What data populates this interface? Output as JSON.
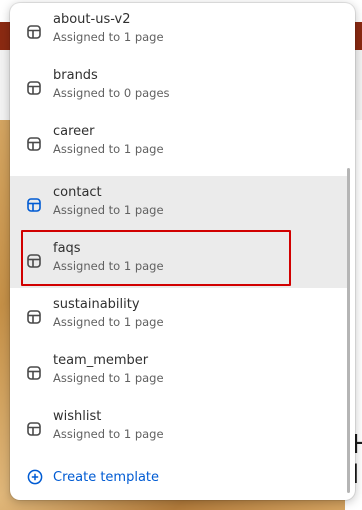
{
  "colors": {
    "accent": "#005bd3",
    "highlight_border": "#d10000",
    "hover_bg": "#ebebeb",
    "icon_default": "#4a4a4a",
    "icon_active": "#005bd3"
  },
  "templates": [
    {
      "name": "about-us-v2",
      "meta": "Assigned to 1 page",
      "icon": "template-icon"
    },
    {
      "name": "brands",
      "meta": "Assigned to 0 pages",
      "icon": "template-icon"
    },
    {
      "name": "career",
      "meta": "Assigned to 1 page",
      "icon": "template-icon"
    },
    {
      "name": "contact",
      "meta": "Assigned to 1 page",
      "icon": "template-icon",
      "selected": true
    },
    {
      "name": "faqs",
      "meta": "Assigned to 1 page",
      "icon": "template-icon",
      "hovered": true
    },
    {
      "name": "sustainability",
      "meta": "Assigned to 1 page",
      "icon": "template-icon"
    },
    {
      "name": "team_member",
      "meta": "Assigned to 1 page",
      "icon": "template-icon"
    },
    {
      "name": "wishlist",
      "meta": "Assigned to 1 page",
      "icon": "template-icon"
    }
  ],
  "create_template": {
    "label": "Create template",
    "icon": "plus-circle-icon"
  },
  "background": {
    "heading_fragment": "H\nl"
  }
}
